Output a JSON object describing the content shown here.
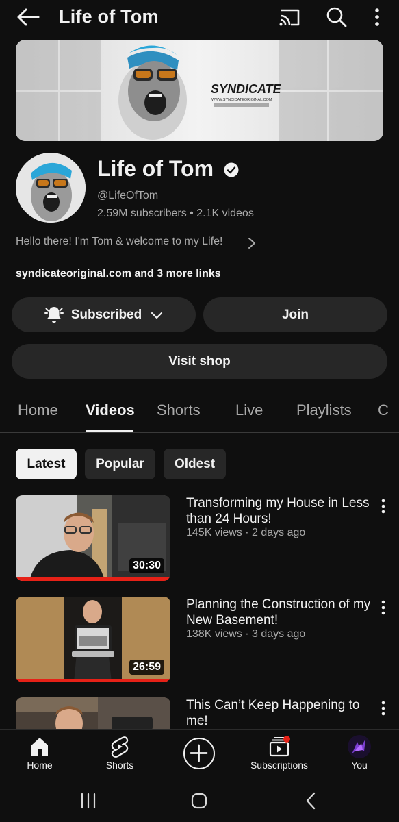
{
  "header": {
    "title": "Life of Tom",
    "icons": [
      "back-arrow-icon",
      "cast-icon",
      "search-icon",
      "more-vert-icon"
    ]
  },
  "banner": {
    "logo_text": "SYNDICATE",
    "logo_subtext": "WWW.SYNDICATEORIGINAL.COM"
  },
  "channel": {
    "name": "Life of Tom",
    "verified": true,
    "handle": "@LifeOfTom",
    "stats": "2.59M subscribers • 2.1K videos",
    "description": "Hello there! I'm Tom & welcome to my Life!",
    "links": "syndicateoriginal.com and 3 more links"
  },
  "actions": {
    "subscribe_label": "Subscribed",
    "join_label": "Join",
    "shop_label": "Visit shop"
  },
  "tabs": [
    {
      "label": "Home",
      "active": false
    },
    {
      "label": "Videos",
      "active": true
    },
    {
      "label": "Shorts",
      "active": false
    },
    {
      "label": "Live",
      "active": false
    },
    {
      "label": "Playlists",
      "active": false
    },
    {
      "label": "C",
      "active": false
    }
  ],
  "sort_chips": [
    {
      "label": "Latest",
      "active": true
    },
    {
      "label": "Popular",
      "active": false
    },
    {
      "label": "Oldest",
      "active": false
    }
  ],
  "videos": [
    {
      "title": "Transforming my House in Less than 24 Hours!",
      "meta": "145K views · 2 days ago",
      "duration": "30:30",
      "watched_fraction": 1.0
    },
    {
      "title": "Planning the Construction of my New Basement!",
      "meta": "138K views · 3 days ago",
      "duration": "26:59",
      "watched_fraction": 1.0
    },
    {
      "title": "This Can’t Keep Happening to me!",
      "meta": "",
      "duration": "",
      "watched_fraction": 0
    }
  ],
  "bottom_nav": {
    "home": "Home",
    "shorts": "Shorts",
    "subscriptions": "Subscriptions",
    "you": "You",
    "subscriptions_has_notification": true
  },
  "colors": {
    "background": "#0f0f0f",
    "surface": "#272727",
    "text_primary": "#f1f1f1",
    "text_secondary": "#aaaaaa",
    "accent_red": "#e62117"
  }
}
